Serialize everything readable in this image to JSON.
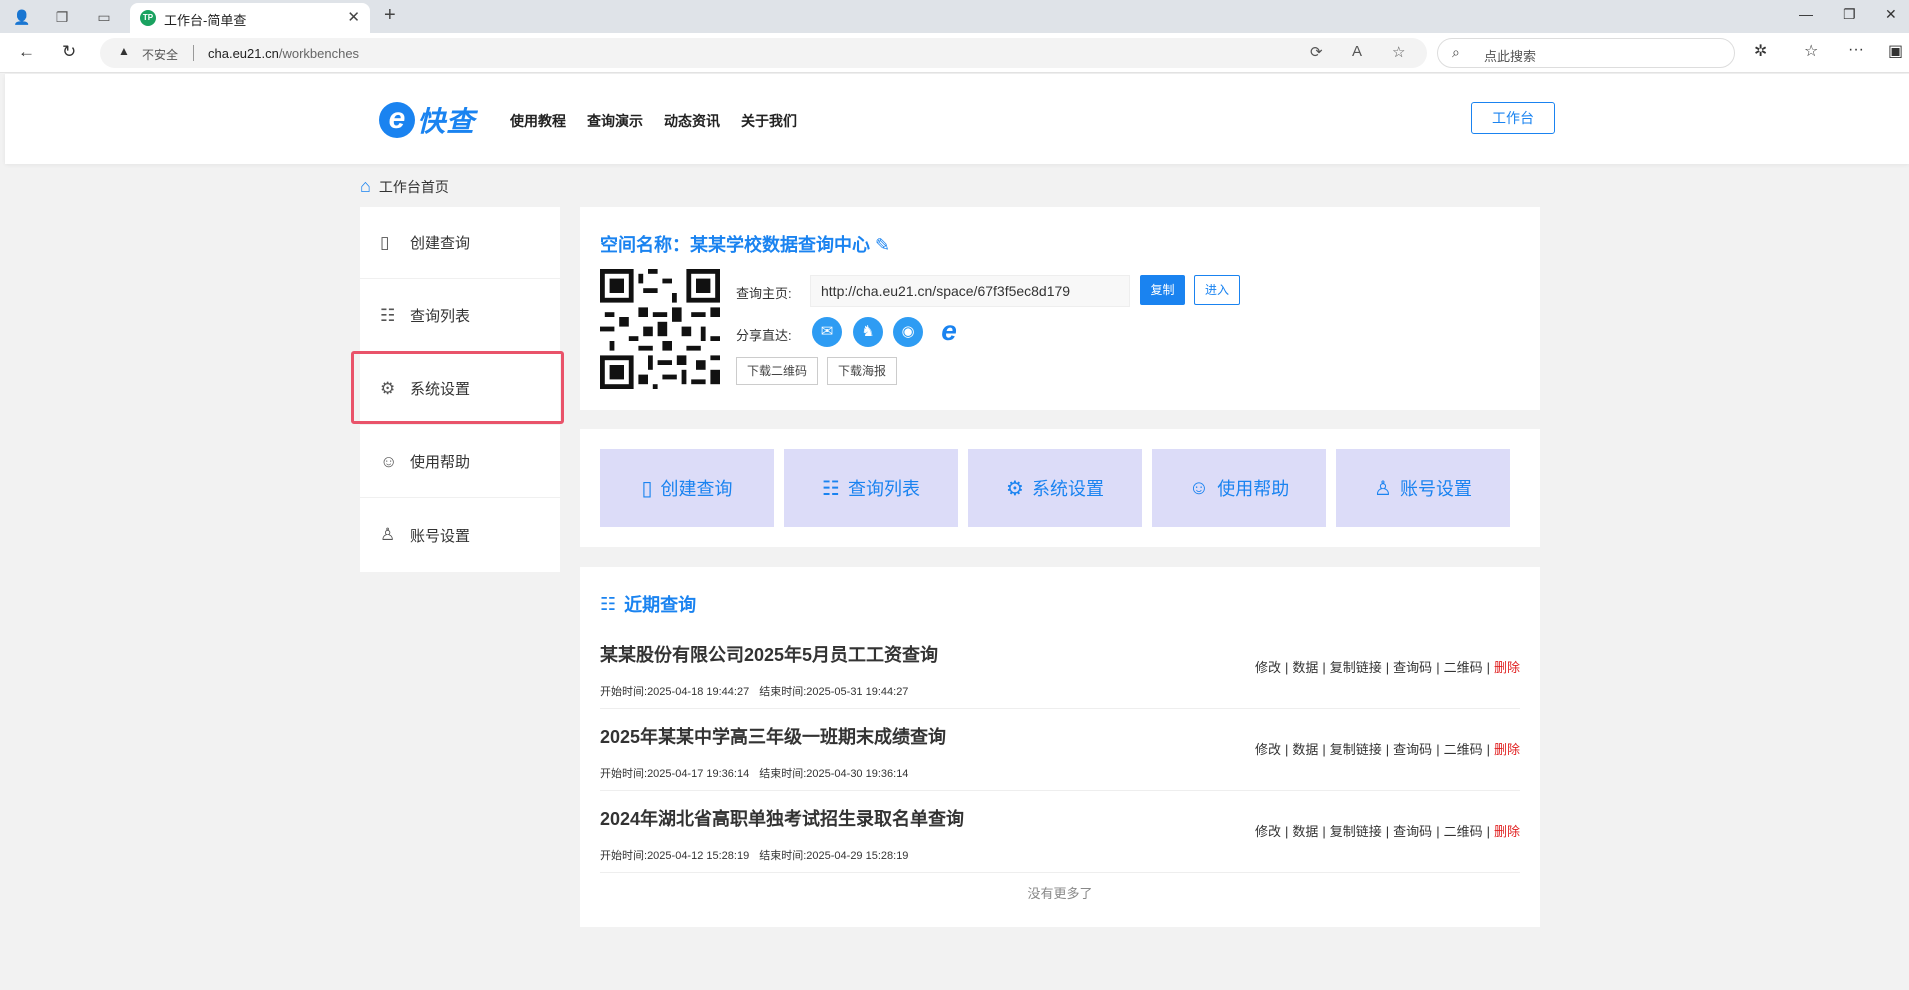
{
  "browser": {
    "tab_title": "工作台-简单查",
    "tab_favicon": "TP",
    "insecure_label": "不安全",
    "url_host": "cha.eu21.cn",
    "url_path": "/workbenches",
    "search_placeholder": "点此搜索"
  },
  "site": {
    "logo_mark": "e",
    "logo_text": "快查",
    "nav": [
      "使用教程",
      "查询演示",
      "动态资讯",
      "关于我们"
    ],
    "workbench_button": "工作台"
  },
  "breadcrumb": {
    "label": "工作台首页"
  },
  "sidebar": {
    "items": [
      {
        "label": "创建查询",
        "icon": "document-icon"
      },
      {
        "label": "查询列表",
        "icon": "list-icon"
      },
      {
        "label": "系统设置",
        "icon": "gear-icon"
      },
      {
        "label": "使用帮助",
        "icon": "smile-icon"
      },
      {
        "label": "账号设置",
        "icon": "user-icon"
      }
    ]
  },
  "space": {
    "title": "空间名称：某某学校数据查询中心",
    "home_label": "查询主页:",
    "home_url": "http://cha.eu21.cn/space/67f3f5ec8d179",
    "copy_button": "复制",
    "enter_button": "进入",
    "share_label": "分享直达:",
    "download_qr_button": "下载二维码",
    "download_poster_button": "下载海报"
  },
  "quick_actions": [
    {
      "label": "创建查询",
      "icon": "document-icon"
    },
    {
      "label": "查询列表",
      "icon": "list-icon"
    },
    {
      "label": "系统设置",
      "icon": "gear-icon"
    },
    {
      "label": "使用帮助",
      "icon": "smile-icon"
    },
    {
      "label": "账号设置",
      "icon": "user-icon"
    }
  ],
  "recent": {
    "title": "近期查询",
    "start_label": "开始时间:",
    "end_label": "结束时间:",
    "actions": [
      "修改",
      "数据",
      "复制链接",
      "查询码",
      "二维码",
      "删除"
    ],
    "items": [
      {
        "name": "某某股份有限公司2025年5月员工工资查询",
        "start": "2025-04-18 19:44:27",
        "end": "2025-05-31 19:44:27"
      },
      {
        "name": "2025年某某中学高三年级一班期末成绩查询",
        "start": "2025-04-17 19:36:14",
        "end": "2025-04-30 19:36:14"
      },
      {
        "name": "2024年湖北省高职单独考试招生录取名单查询",
        "start": "2025-04-12 15:28:19",
        "end": "2025-04-29 15:28:19"
      }
    ],
    "no_more": "没有更多了"
  },
  "colors": {
    "brand": "#1a83f0",
    "highlight": "#e9536a",
    "delete": "#e02020",
    "quick_bg": "#dcdcf8"
  }
}
